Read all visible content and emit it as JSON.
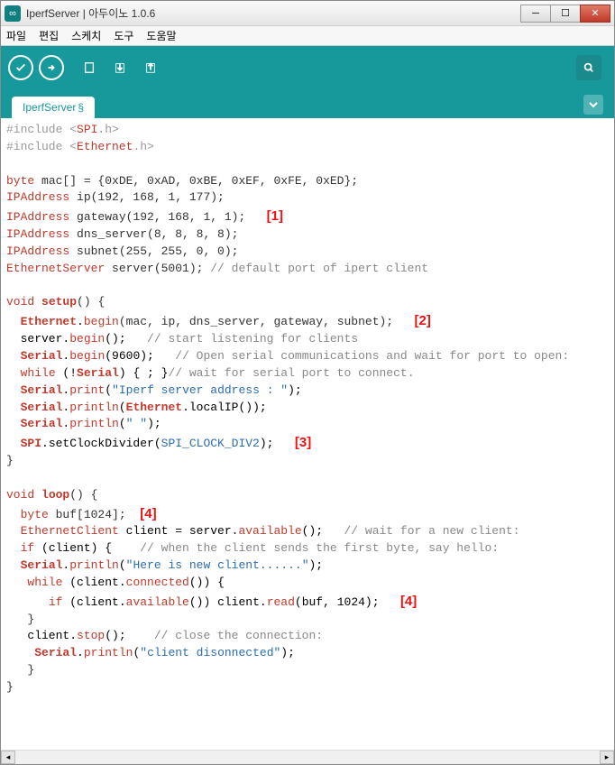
{
  "window": {
    "title": "IperfServer | 아두이노 1.0.6"
  },
  "menu": {
    "file": "파일",
    "edit": "편집",
    "sketch": "스케치",
    "tools": "도구",
    "help": "도움말"
  },
  "tab": {
    "name": "IperfServer",
    "mod": "§"
  },
  "annotations": {
    "a1": "[1]",
    "a2": "[2]",
    "a3": "[3]",
    "a4": "[4]"
  },
  "code": {
    "l1_a": "#include <",
    "l1_b": "SPI",
    "l1_c": ".h>",
    "l2_a": "#include <",
    "l2_b": "Ethernet",
    "l2_c": ".h>",
    "l4_a": "byte",
    "l4_b": " mac[] = {0xDE, 0xAD, 0xBE, 0xEF, 0xFE, 0xED};",
    "l5_a": "IPAddress",
    "l5_b": " ip(192, 168, 1, 177);",
    "l6_a": "IPAddress",
    "l6_b": " gateway(192, 168, 1, 1);",
    "l7_a": "IPAddress",
    "l7_b": " dns_server(8, 8, 8, 8);",
    "l8_a": "IPAddress",
    "l8_b": " subnet(255, 255, 0, 0);",
    "l9_a": "EthernetServer",
    "l9_b": " server(5001); ",
    "l9_c": "// default port of ipert client",
    "l11_a": "void",
    "l11_b": " ",
    "l11_c": "setup",
    "l11_d": "() {",
    "l12_a": "  ",
    "l12_b": "Ethernet",
    "l12_c": ".",
    "l12_d": "begin",
    "l12_e": "(mac, ip, dns_server, gateway, subnet);",
    "l13_a": "  server.",
    "l13_b": "begin",
    "l13_c": "();   ",
    "l13_d": "// start listening for clients",
    "l14_a": "  ",
    "l14_b": "Serial",
    "l14_c": ".",
    "l14_d": "begin",
    "l14_e": "(9600);   ",
    "l14_f": "// Open serial communications and wait for port to open:",
    "l15_a": "  ",
    "l15_b": "while",
    "l15_c": " (!",
    "l15_d": "Serial",
    "l15_e": ") { ; }",
    "l15_f": "// wait for serial port to connect.",
    "l16_a": "  ",
    "l16_b": "Serial",
    "l16_c": ".",
    "l16_d": "print",
    "l16_e": "(",
    "l16_f": "\"Iperf server address : \"",
    "l16_g": ");",
    "l17_a": "  ",
    "l17_b": "Serial",
    "l17_c": ".",
    "l17_d": "println",
    "l17_e": "(",
    "l17_f": "Ethernet",
    "l17_g": ".localIP());",
    "l18_a": "  ",
    "l18_b": "Serial",
    "l18_c": ".",
    "l18_d": "println",
    "l18_e": "(",
    "l18_f": "\" \"",
    "l18_g": ");",
    "l19_a": "  ",
    "l19_b": "SPI",
    "l19_c": ".setClockDivider(",
    "l19_d": "SPI_CLOCK_DIV2",
    "l19_e": ");",
    "l20": "}",
    "l22_a": "void",
    "l22_b": " ",
    "l22_c": "loop",
    "l22_d": "() {",
    "l23_a": "  ",
    "l23_b": "byte",
    "l23_c": " buf[1024];",
    "l24_a": "  ",
    "l24_b": "EthernetClient",
    "l24_c": " client = server.",
    "l24_d": "available",
    "l24_e": "();   ",
    "l24_f": "// wait for a new client:",
    "l25_a": "  ",
    "l25_b": "if",
    "l25_c": " (client) {    ",
    "l25_d": "// when the client sends the first byte, say hello:",
    "l26_a": "  ",
    "l26_b": "Serial",
    "l26_c": ".",
    "l26_d": "println",
    "l26_e": "(",
    "l26_f": "\"Here is new client......\"",
    "l26_g": ");",
    "l27_a": "   ",
    "l27_b": "while",
    "l27_c": " (client.",
    "l27_d": "connected",
    "l27_e": "()) {",
    "l28_a": "      ",
    "l28_b": "if",
    "l28_c": " (client.",
    "l28_d": "available",
    "l28_e": "()) client.",
    "l28_f": "read",
    "l28_g": "(buf, 1024);",
    "l29": "   }",
    "l30_a": "   client.",
    "l30_b": "stop",
    "l30_c": "();    ",
    "l30_d": "// close the connection:",
    "l31_a": "    ",
    "l31_b": "Serial",
    "l31_c": ".",
    "l31_d": "println",
    "l31_e": "(",
    "l31_f": "\"client disonnected\"",
    "l31_g": ");",
    "l32": "   }",
    "l33": "}"
  }
}
